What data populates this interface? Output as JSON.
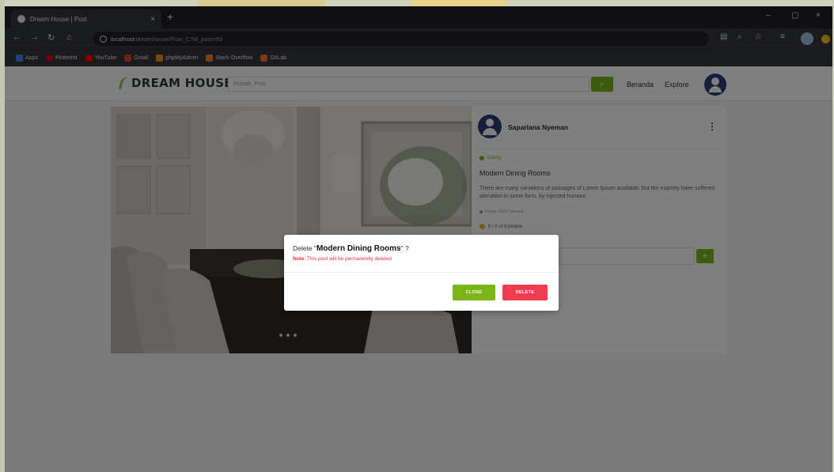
{
  "browser": {
    "tab_title": "Dream House | Post",
    "tab_close": "×",
    "new_tab": "+",
    "url_host": "localhost",
    "url_path": "/dreamhouse/Post_C?id_post=59",
    "window": {
      "minimize": "–",
      "maximize": "▢",
      "close": "×"
    },
    "bookmarks": [
      {
        "label": "Apps",
        "color": "#4285f4"
      },
      {
        "label": "Pinterest",
        "color": "#e60023"
      },
      {
        "label": "YouTube",
        "color": "#ff0000"
      },
      {
        "label": "Gmail",
        "color": "#ea4335"
      },
      {
        "label": "phpMyAdmin",
        "color": "#f29111"
      },
      {
        "label": "Stack Overflow",
        "color": "#f48024"
      },
      {
        "label": "GitLab",
        "color": "#fc6d26"
      }
    ]
  },
  "site": {
    "brand": "DREAM HOUSE",
    "search_placeholder": "Rumah, Post.",
    "nav": [
      "Beranda",
      "Explore"
    ],
    "accent": "#7cb518"
  },
  "post": {
    "author": "Saparlana Nyeman",
    "status": "Eating",
    "title": "Modern Dining Rooms",
    "description": "There are many variations of passages of Lorem Ipsum available, but the majority have suffered alteration in some form, by injected humour.",
    "date": "Friday 2021 Viewed",
    "likes": "0 / 0 of 0 people"
  },
  "modal": {
    "prefix": "Delete \"",
    "post_title": "Modern Dining Rooms",
    "suffix": "\" ?",
    "note_label": "Note",
    "note": ": This post will be permanently deleted",
    "close_label": "CLOSE",
    "delete_label": "DELETE",
    "delete_color": "#f03c50"
  }
}
